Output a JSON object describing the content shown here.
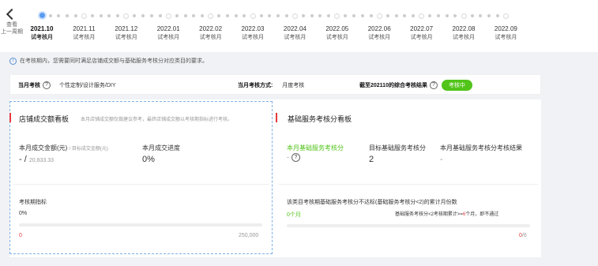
{
  "nav": {
    "back_label_1": "查看",
    "back_label_2": "上一周期"
  },
  "timeline": {
    "months": [
      {
        "label": "2021.10",
        "sub": "试考核月"
      },
      {
        "label": "2021.11",
        "sub": "试考核月"
      },
      {
        "label": "2021.12",
        "sub": "试考核月"
      },
      {
        "label": "2022.01",
        "sub": "试考核月"
      },
      {
        "label": "2022.02",
        "sub": "试考核月"
      },
      {
        "label": "2022.03",
        "sub": "试考核月"
      },
      {
        "label": "2022.04",
        "sub": "试考核月"
      },
      {
        "label": "2022.05",
        "sub": "试考核月"
      },
      {
        "label": "2022.06",
        "sub": "试考核月"
      },
      {
        "label": "2022.07",
        "sub": "试考核月"
      },
      {
        "label": "2022.08",
        "sub": "试考核月"
      },
      {
        "label": "2022.09",
        "sub": "试考核月"
      }
    ],
    "active_index": 0
  },
  "info": {
    "text": "在考核期内，您需要同时满足店铺成交额与基础服务考核分对应类目的要求。",
    "icon": "info-icon"
  },
  "summary": {
    "category_label": "当月考核",
    "category_value": "个性定制/设计服务/DIY",
    "method_label": "当月考核方式:",
    "method_value": "月度考核",
    "result_label": "截至202110的综合考核结果",
    "result_badge": "考核中",
    "help_glyph": "?"
  },
  "gmv_panel": {
    "title": "店铺成交额看板",
    "subtitle": "本月店铺成交额仅做建议参考，最终店铺成交额以考核期指标进行考核。",
    "amount_label": "本月成交金额(元)",
    "target_label": "/ 目标成交金额(元)",
    "amount_value": "- /",
    "target_value": "20,833.33",
    "progress_label": "本月成交进度",
    "progress_value": "0%",
    "period_label": "考核期指标",
    "period_pct": "0%",
    "bar_min": "0",
    "bar_max": "250,000",
    "progress_fraction": 0
  },
  "service_panel": {
    "title": "基础服务考核分看板",
    "score_label": "本月基础服务考核分",
    "score_value": "-",
    "help_glyph": "?",
    "target_label": "目标基础服务考核分",
    "target_value": "2",
    "result_label": "本月基础服务考核分考核结果",
    "result_value": "-",
    "fail_text": "该类目考核期基础服务考核分不达标(基础服务考核分<2)的累计月份数",
    "fail_count": "0个月",
    "rule_prefix": "基础服务考核分<2考核期累计>=",
    "rule_count": "6",
    "rule_suffix": "个月，即不通过",
    "bar_current": "0",
    "bar_total": "/6",
    "progress_fraction": 0
  },
  "colors": {
    "accent_red": "#e4393c",
    "accent_green": "#52c41a",
    "active_dot": "#5b9bf0"
  }
}
